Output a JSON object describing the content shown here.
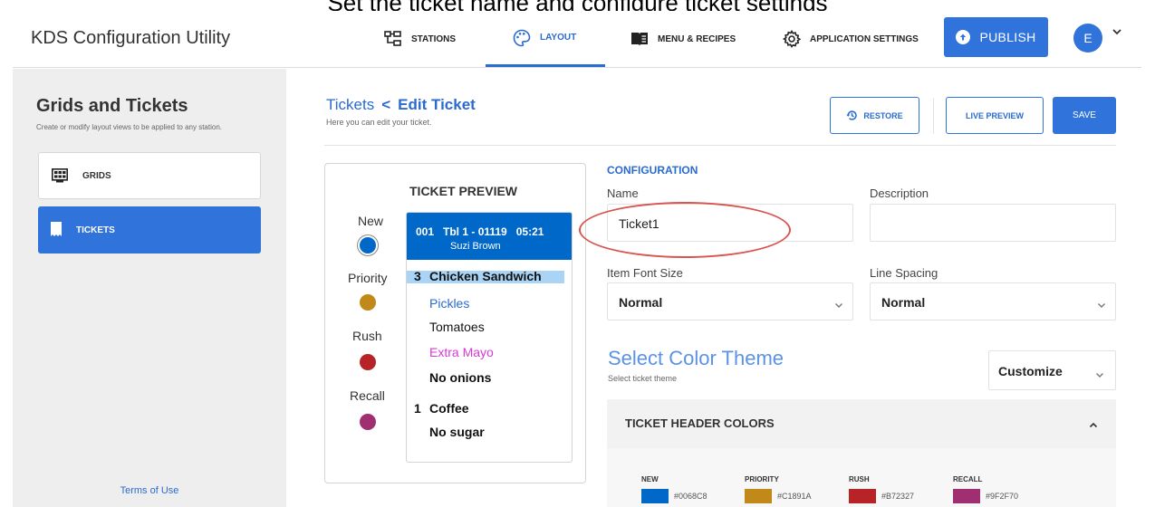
{
  "caption": "Set the ticket name and configure ticket settings",
  "app_title": "KDS Configuration Utility",
  "nav": [
    {
      "label": "STATIONS",
      "icon": "stations-icon"
    },
    {
      "label": "LAYOUT",
      "icon": "palette-icon",
      "active": true
    },
    {
      "label": "MENU & RECIPES",
      "icon": "book-icon"
    },
    {
      "label": "APPLICATION SETTINGS",
      "icon": "gear-icon"
    }
  ],
  "publish_label": "PUBLISH",
  "avatar_letter": "E",
  "sidebar": {
    "title": "Grids and Tickets",
    "subtitle": "Create or modify layout views to be applied to any station.",
    "items": [
      {
        "label": "GRIDS",
        "icon": "grid-icon"
      },
      {
        "label": "TICKETS",
        "icon": "ticket-icon",
        "active": true
      }
    ],
    "terms": "Terms of Use"
  },
  "breadcrumb": {
    "parent": "Tickets",
    "sep": "<",
    "current": "Edit Ticket",
    "subtitle": "Here you can edit your ticket."
  },
  "buttons": {
    "restore": "RESTORE",
    "live_preview": "LIVE PREVIEW",
    "save": "SAVE"
  },
  "preview": {
    "title": "TICKET PREVIEW",
    "legend": [
      {
        "label": "New",
        "color": "#0068C8"
      },
      {
        "label": "Priority",
        "color": "#C1891A"
      },
      {
        "label": "Rush",
        "color": "#B72327"
      },
      {
        "label": "Recall",
        "color": "#9F2F70"
      }
    ],
    "ticket": {
      "header_line1": "001   Tbl 1 - 01119   05:21",
      "header_line2": "Suzi Brown",
      "items": [
        {
          "qty": "3",
          "name": "Chicken Sandwich",
          "modifiers": [
            "Pickles",
            "Tomatoes",
            "Extra Mayo",
            "No onions"
          ]
        },
        {
          "qty": "1",
          "name": "Coffee",
          "modifiers": [
            "No sugar"
          ]
        }
      ]
    }
  },
  "config": {
    "title": "CONFIGURATION",
    "name_label": "Name",
    "name_value": "Ticket1",
    "description_label": "Description",
    "description_value": "",
    "font_size_label": "Item Font Size",
    "font_size_value": "Normal",
    "line_spacing_label": "Line Spacing",
    "line_spacing_value": "Normal"
  },
  "theme": {
    "title": "Select Color Theme",
    "subtitle": "Select ticket theme",
    "dropdown": "Customize",
    "section": "TICKET HEADER COLORS",
    "swatches": [
      {
        "label": "NEW",
        "hex": "#0068C8"
      },
      {
        "label": "PRIORITY",
        "hex": "#C1891A"
      },
      {
        "label": "RUSH",
        "hex": "#B72327"
      },
      {
        "label": "RECALL",
        "hex": "#9F2F70"
      }
    ]
  },
  "colors": {
    "accent": "#2f73db",
    "link": "#2a6bd1",
    "highlight": "#aad4f5",
    "annotation": "#d9534f",
    "mod_blue": "#2a6bd1",
    "mod_magenta": "#d63ad6"
  }
}
